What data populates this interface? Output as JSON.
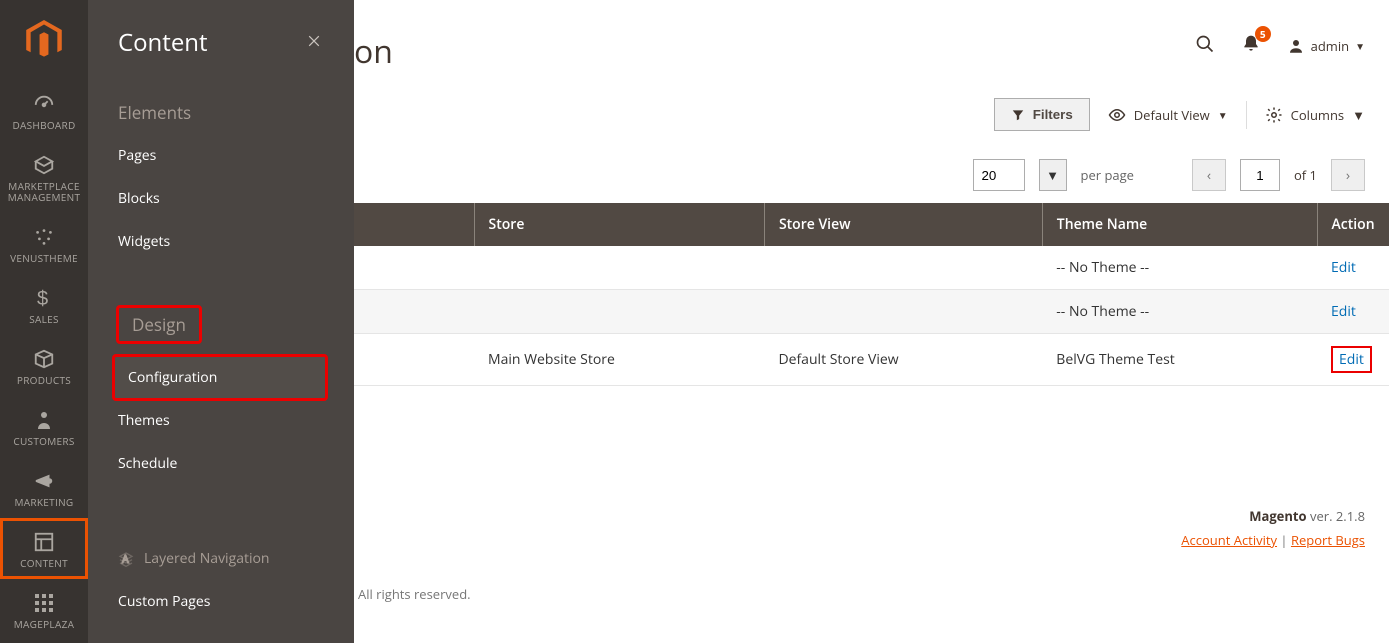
{
  "sidebar": {
    "items": [
      {
        "label": "DASHBOARD"
      },
      {
        "label": "MARKETPLACE MANAGEMENT"
      },
      {
        "label": "VENUSTHEME"
      },
      {
        "label": "SALES"
      },
      {
        "label": "PRODUCTS"
      },
      {
        "label": "CUSTOMERS"
      },
      {
        "label": "MARKETING"
      },
      {
        "label": "CONTENT"
      },
      {
        "label": "MAGEPLAZA"
      }
    ]
  },
  "submenu": {
    "title": "Content",
    "sections": {
      "elements": {
        "heading": "Elements",
        "items": [
          "Pages",
          "Blocks",
          "Widgets"
        ]
      },
      "design": {
        "heading": "Design",
        "items": [
          "Configuration",
          "Themes",
          "Schedule"
        ]
      },
      "layered": {
        "heading": "Layered Navigation",
        "items": [
          "Custom Pages"
        ]
      }
    }
  },
  "page": {
    "title_peek": "on",
    "toolbar": {
      "filters": "Filters",
      "default_view": "Default View",
      "columns": "Columns"
    },
    "pager": {
      "per_page_value": "20",
      "per_page_label": "per page",
      "page_value": "1",
      "of_label": "of 1"
    },
    "grid": {
      "headers": [
        "Store",
        "Store View",
        "Theme Name",
        "Action"
      ],
      "rows": [
        {
          "store": "",
          "store_view": "",
          "theme": "-- No Theme --",
          "action": "Edit"
        },
        {
          "store": "",
          "store_view": "",
          "theme": "-- No Theme --",
          "action": "Edit"
        },
        {
          "store": "Main Website Store",
          "store_view": "Default Store View",
          "theme": "BelVG Theme Test",
          "action": "Edit"
        }
      ]
    }
  },
  "header": {
    "notifications_count": "5",
    "admin_label": "admin"
  },
  "footer": {
    "copyright": "All rights reserved.",
    "version_label": "Magento",
    "version_rest": " ver. 2.1.8",
    "account_activity": "Account Activity",
    "report_bugs": "Report Bugs"
  }
}
